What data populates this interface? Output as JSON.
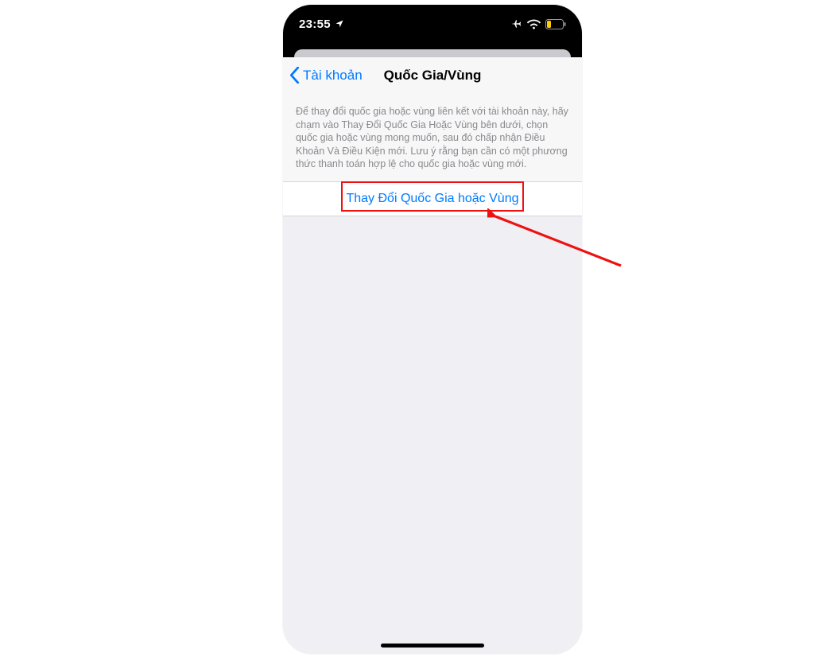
{
  "status": {
    "time": "23:55",
    "icons": {
      "location": "location-icon",
      "airplane": "airplane-icon",
      "wifi": "wifi-icon",
      "battery": "battery-low-icon"
    }
  },
  "nav": {
    "back_label": "Tài khoản",
    "title": "Quốc Gia/Vùng"
  },
  "description": "Để thay đổi quốc gia hoặc vùng liên kết với tài khoản này, hãy chạm vào Thay Đổi Quốc Gia Hoặc Vùng bên dưới, chọn quốc gia hoặc vùng mong muốn, sau đó chấp nhận Điều Khoản Và Điều Kiện mới. Lưu ý rằng bạn cần có một phương thức thanh toán hợp lệ cho quốc gia hoặc vùng mới.",
  "action": {
    "change_label": "Thay Đổi Quốc Gia hoặc Vùng"
  },
  "annotation": {
    "highlight_color": "#e11"
  }
}
